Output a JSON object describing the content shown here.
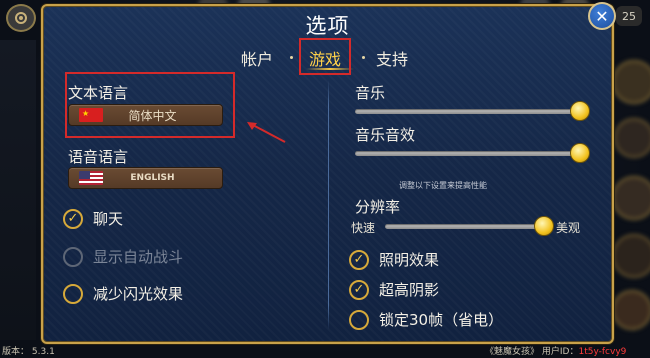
{
  "window": {
    "title": "选项",
    "close_icon": "close-icon"
  },
  "tabs": [
    {
      "label": "帐户",
      "active": false
    },
    {
      "label": "游戏",
      "active": true
    },
    {
      "label": "支持",
      "active": false
    }
  ],
  "text_language": {
    "label": "文本语言",
    "value": "简体中文",
    "flag": "china-flag-icon"
  },
  "voice_language": {
    "label": "语音语言",
    "value": "ENGLISH",
    "flag": "usa-flag-icon"
  },
  "left_options": [
    {
      "label": "聊天",
      "checked": true,
      "enabled": true
    },
    {
      "label": "显示自动战斗",
      "checked": false,
      "enabled": false
    },
    {
      "label": "减少闪光效果",
      "checked": false,
      "enabled": true
    }
  ],
  "audio": {
    "music_label": "音乐",
    "music_level": 1.0,
    "sfx_label": "音乐音效",
    "sfx_level": 1.0
  },
  "performance_hint": "调整以下设置来提高性能",
  "resolution": {
    "label": "分辨率",
    "min_label": "快速",
    "max_label": "美观",
    "level": 0.92
  },
  "right_options": [
    {
      "label": "照明效果",
      "checked": true
    },
    {
      "label": "超高阴影",
      "checked": true
    },
    {
      "label": "锁定30帧（省电）",
      "checked": false
    }
  ],
  "footer": {
    "version_label": "版本：",
    "version": "5.3.1",
    "game_name": "《魅魔女孩》",
    "user_id_label": "用户ID：",
    "user_id": "1t5y-fcvy9"
  },
  "background": {
    "counter": "25"
  },
  "colors": {
    "panel_border": "#c9a24a",
    "active_tab": "#ffd24a",
    "annotation_red": "#d42a2a",
    "checkbox_gold": "#d6a93a"
  }
}
